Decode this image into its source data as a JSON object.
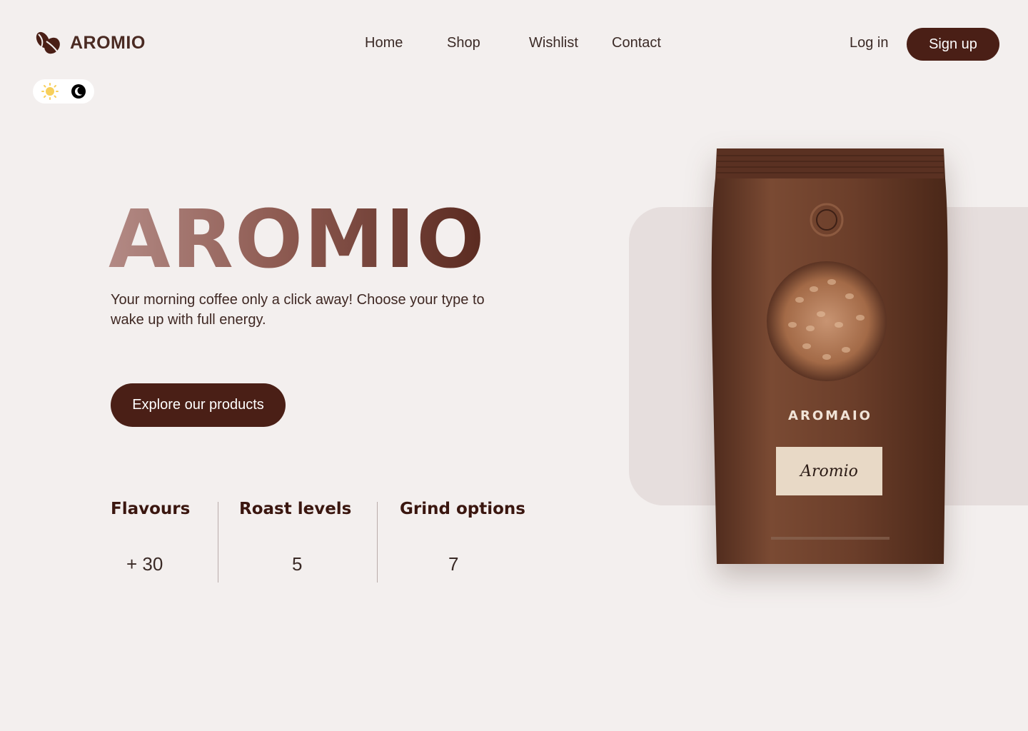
{
  "header": {
    "logo_text": "AROMIO",
    "nav": [
      "Home",
      "Shop",
      "Wishlist",
      "Contact"
    ],
    "login_label": "Log in",
    "signup_label": "Sign up"
  },
  "theme_toggle": {
    "icons": [
      "sun-icon",
      "moon-icon"
    ]
  },
  "hero": {
    "title": "AROMIO",
    "subtitle": "Your morning coffee only a click away! Choose your type to wake up with full energy.",
    "cta_label": "Explore our products"
  },
  "stats": [
    {
      "label": "Flavours",
      "value": "+ 30"
    },
    {
      "label": "Roast levels",
      "value": "5"
    },
    {
      "label": "Grind options",
      "value": "7"
    }
  ],
  "product": {
    "bag_brand": "AROMAIO",
    "bag_label": "Aromio"
  },
  "colors": {
    "background": "#f3efee",
    "accent": "#4a1f16",
    "panel": "#e6dedd"
  }
}
